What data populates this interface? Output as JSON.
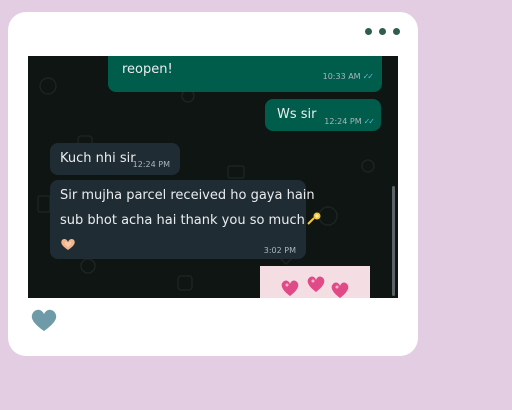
{
  "messages": [
    {
      "direction": "out",
      "text": "reopen!",
      "time": "10:33 AM",
      "status": "read"
    },
    {
      "direction": "out",
      "text": "Ws sir",
      "time": "12:24 PM",
      "status": "read"
    },
    {
      "direction": "in",
      "text": "Kuch nhi sir",
      "time": "12:24 PM"
    },
    {
      "direction": "in",
      "lines": [
        "Sir mujha parcel received ho gaya hain",
        "sub bhot acha hai thank you so much"
      ],
      "time": "3:02 PM"
    }
  ],
  "icons": {
    "menu": "more-dots-icon",
    "like": "heart-icon",
    "read": "double-check-icon",
    "emoji_1": "dizzy-emoji",
    "emoji_2": "heart-hands-emoji",
    "preview_emojis": "pink-hearts-emoji"
  },
  "colors": {
    "page_background": "#e2cde2",
    "card": "#ffffff",
    "chat_background": "#0f1512",
    "outgoing_bubble": "#005c4b",
    "incoming_bubble": "#202c33",
    "read_ticks": "#53bdeb",
    "heart": "#6f9aa8"
  }
}
